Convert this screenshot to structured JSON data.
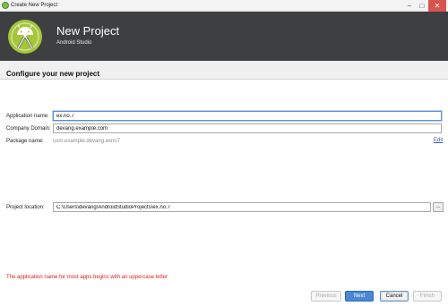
{
  "window": {
    "title": "Create New Project"
  },
  "header": {
    "title": "New Project",
    "subtitle": "Android Studio"
  },
  "page": {
    "section_title": "Configure your new project"
  },
  "form": {
    "app_name_label": "Application name:",
    "app_name_value": "ex.no.7",
    "domain_label": "Company Domain:",
    "domain_value": "devang.example.com",
    "package_label": "Package name:",
    "package_value": "com.example.devang.exno7",
    "edit_link": "Edit",
    "location_label": "Project location:",
    "location_value": "C:\\Users\\devang\\AndroidStudioProjects\\ex.no.7",
    "browse_label": "..."
  },
  "validation": {
    "message": "The application name for most apps begins with an uppercase letter"
  },
  "buttons": {
    "previous": "Previous",
    "next": "Next",
    "cancel": "Cancel",
    "finish": "Finish"
  },
  "colors": {
    "banner": "#3d3f41",
    "logo_green": "#a4c639",
    "error": "#e0201e",
    "primary": "#4a88d4"
  }
}
